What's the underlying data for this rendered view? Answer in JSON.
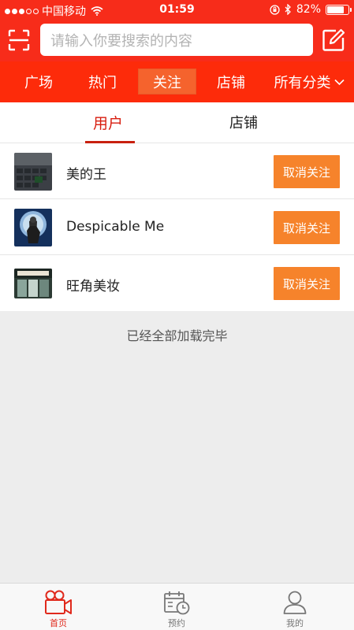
{
  "status_bar": {
    "carrier": "中国移动",
    "time": "01:59",
    "battery": "82%",
    "battery_level": 0.82,
    "signal_bars_filled": 3,
    "signal_bars_total": 5
  },
  "search": {
    "placeholder": "请输入你要搜索的内容"
  },
  "top_tabs": [
    {
      "label": "广场"
    },
    {
      "label": "热门"
    },
    {
      "label": "关注",
      "active": true
    },
    {
      "label": "店铺"
    },
    {
      "label": "所有分类"
    }
  ],
  "sub_tabs": [
    {
      "label": "用户",
      "active": true
    },
    {
      "label": "店铺"
    }
  ],
  "follow_list": [
    {
      "name": "美的王",
      "button": "取消关注"
    },
    {
      "name": "Despicable Me",
      "button": "取消关注"
    },
    {
      "name": "旺角美妆",
      "button": "取消关注"
    }
  ],
  "list_end_text": "已经全部加载完毕",
  "bottom_nav": [
    {
      "label": "首页",
      "icon": "video-camera-icon",
      "active": true
    },
    {
      "label": "预约",
      "icon": "calendar-clock-icon"
    },
    {
      "label": "我的",
      "icon": "person-icon"
    }
  ],
  "colors": {
    "brand_red": "#f72c1a",
    "tab_bar_red": "#fd2b0a",
    "active_tab_bg": "#f5632d",
    "button_orange": "#f6832b",
    "active_nav": "#e0291c"
  }
}
